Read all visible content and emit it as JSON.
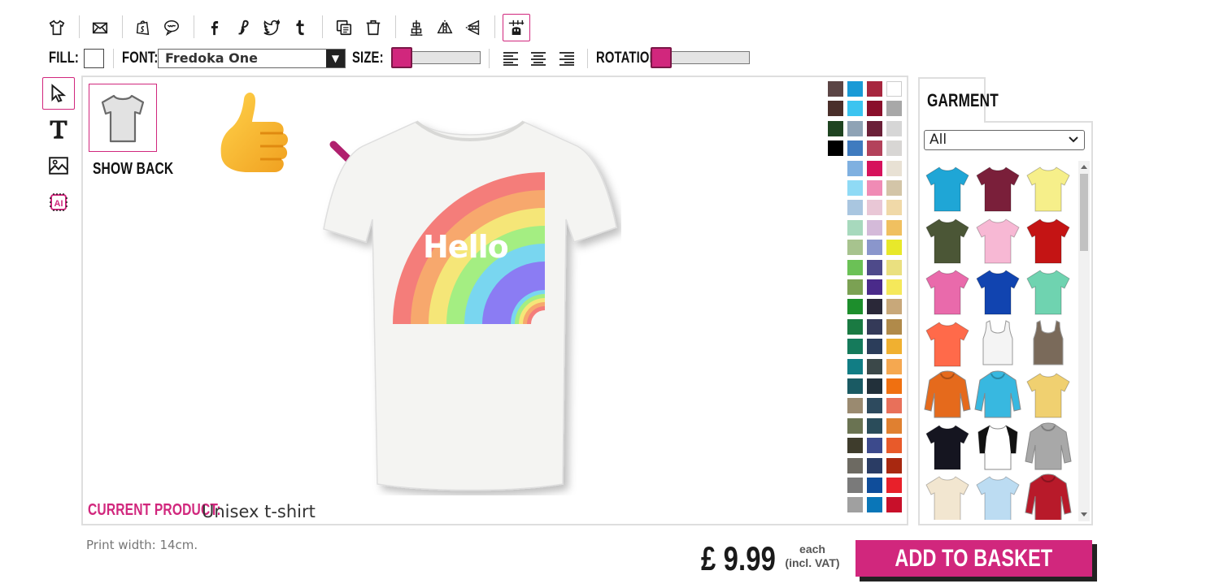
{
  "toolbar": {
    "icons": [
      "tshirt-icon",
      "envelope-icon",
      "shopify-icon",
      "speech-bubble-icon",
      "facebook-icon",
      "etsy-icon",
      "twitter-icon",
      "tumblr-icon",
      "duplicate-icon",
      "delete-icon",
      "align-center-icon",
      "flip-horizontal-icon",
      "flip-vertical-icon",
      "grid-snap-icon"
    ]
  },
  "text_options": {
    "fill_label": "FILL:",
    "fill_color": "#ffffff",
    "font_label": "FONT:",
    "font_value": "Fredoka One",
    "size_label": "SIZE:",
    "rotation_label": "ROTATION:",
    "accent": "#d1277d"
  },
  "left_tools": [
    "select-tool",
    "text-tool",
    "image-tool",
    "ai-tool"
  ],
  "canvas": {
    "show_back_label": "SHOW BACK",
    "design_text": "Hello",
    "current_product_label": "CURRENT PRODUCT:",
    "current_product_value": "Unisex t-shirt"
  },
  "palette": {
    "columns": [
      [
        "#5b4545",
        "#4a2f2a",
        "#1f4421",
        "#000000"
      ],
      [
        "#1a9ad6",
        "#3bc4f0",
        "#8fa3b5",
        "#3f7bbf",
        "#7fb0e0",
        "#8fdaf5",
        "#a9c6e0",
        "#a7d9bd",
        "#a7c38e",
        "#6bc156",
        "#7ba153",
        "#1d8e2c",
        "#1a7a42",
        "#157a5b",
        "#117d84",
        "#1a5a63",
        "#9a8a70",
        "#6a7352",
        "#3e3c2c",
        "#6d6a62",
        "#7a7a7a",
        "#a0a0a0"
      ],
      [
        "#a7273f",
        "#8a0f2b",
        "#6b2038",
        "#b3425b",
        "#d6125c",
        "#f08bb5",
        "#e9c7d6",
        "#d4bad9",
        "#8a96cc",
        "#4e4a8a",
        "#4a2a8a",
        "#2a2838",
        "#343a58",
        "#2b3d5a",
        "#3b4849",
        "#22303a",
        "#2d4a5e",
        "#2a4c5a",
        "#3c4a8c",
        "#2a3c64",
        "#0f4d9a",
        "#0a76b8"
      ],
      [
        "#ffffff",
        "#a8a8a8",
        "#d6d6d6",
        "#d8d6d4",
        "#e8e1d4",
        "#d3c5a8",
        "#f0d9a8",
        "#f0c060",
        "#e8e82a",
        "#eae080",
        "#f5e85a",
        "#c8a87a",
        "#b08a4a",
        "#f0b030",
        "#f5a850",
        "#f07010",
        "#e8705a",
        "#e08030",
        "#e85a2a",
        "#a82810",
        "#e8202a",
        "#c8102a"
      ]
    ]
  },
  "garment": {
    "tab_label": "GARMENT",
    "filter_value": "All",
    "items": [
      {
        "name": "tshirt-blue",
        "color": "#1fa6d6"
      },
      {
        "name": "tshirt-maroon",
        "color": "#7a1f3a"
      },
      {
        "name": "tshirt-yellow",
        "color": "#f6ef8a"
      },
      {
        "name": "tshirt-olive",
        "color": "#4b5636"
      },
      {
        "name": "tshirt-pink",
        "color": "#f7b8d4"
      },
      {
        "name": "tshirt-red",
        "color": "#c41414"
      },
      {
        "name": "tshirt-hot-pink",
        "color": "#e96aab"
      },
      {
        "name": "tshirt-royal-blue",
        "color": "#1144b0"
      },
      {
        "name": "tshirt-mint",
        "color": "#6fd3b0"
      },
      {
        "name": "tshirt-coral",
        "color": "#ff6a4a"
      },
      {
        "name": "tank-white",
        "color": "#f4f4f4"
      },
      {
        "name": "tank-brown",
        "color": "#7a6a5a"
      },
      {
        "name": "hoodie-orange",
        "color": "#e56a1c"
      },
      {
        "name": "hoodie-cyan",
        "color": "#38b8e0"
      },
      {
        "name": "tshirt-tie-dye",
        "color": "#f0d070"
      },
      {
        "name": "tshirt-black",
        "color": "#151520"
      },
      {
        "name": "raglan-black-white",
        "color": "#ffffff"
      },
      {
        "name": "hoodie-grey",
        "color": "#a8a8a8"
      },
      {
        "name": "tshirt-cream",
        "color": "#f2e6d0"
      },
      {
        "name": "tshirt-ombre-blue",
        "color": "#bcdcf2"
      },
      {
        "name": "varsity-jacket-red",
        "color": "#b81a2a"
      }
    ]
  },
  "footer": {
    "print_width": "Print width: 14cm.",
    "price": "£ 9.99",
    "each_line1": "each",
    "each_line2": "(incl. VAT)",
    "basket_label": "ADD TO BASKET"
  }
}
